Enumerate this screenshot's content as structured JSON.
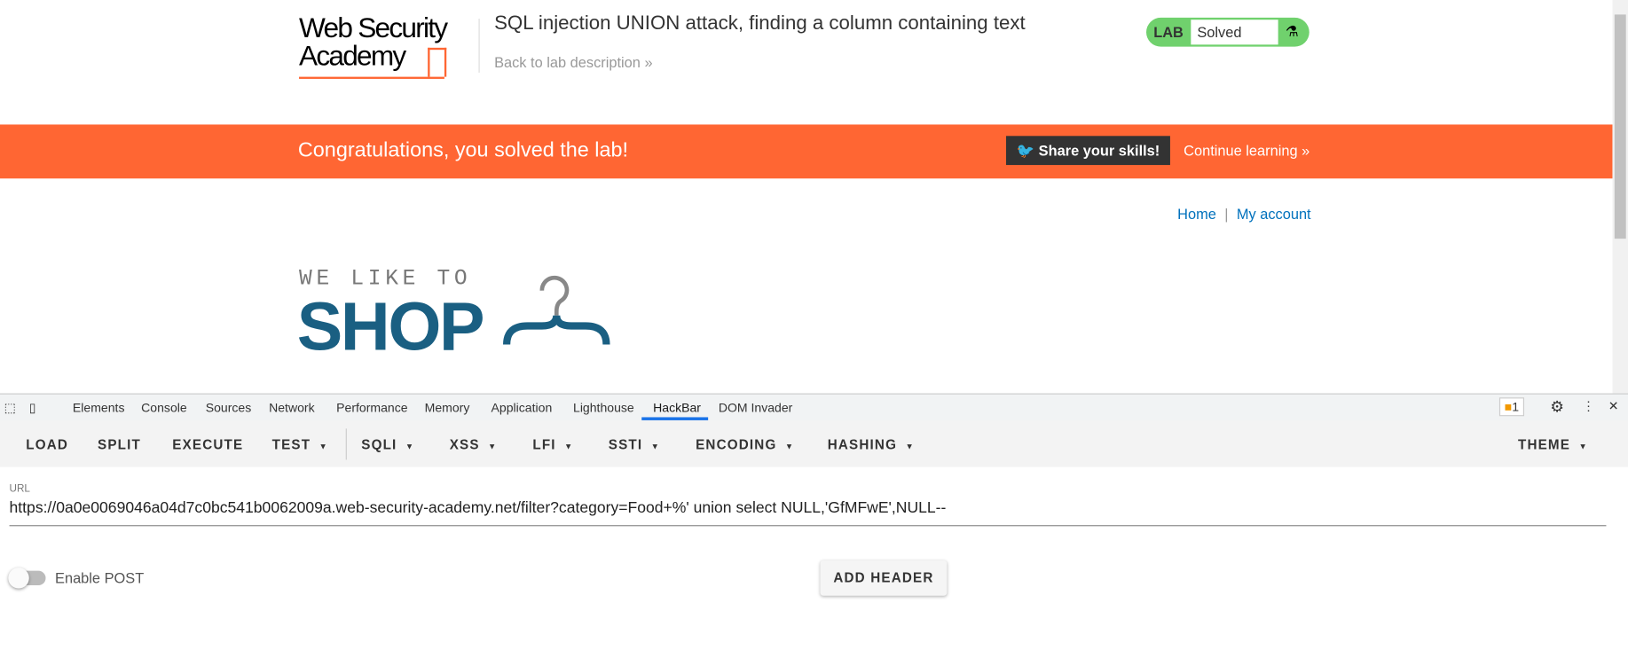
{
  "header": {
    "logo_line1": "Web Security",
    "logo_line2": "Academy",
    "title": "SQL injection UNION attack, finding a column containing text",
    "back_link": "Back to lab description »",
    "lab_label": "LAB",
    "lab_status": "Solved"
  },
  "banner": {
    "message": "Congratulations, you solved the lab!",
    "share": "Share your skills!",
    "continue": "Continue learning »"
  },
  "nav": {
    "home": "Home",
    "sep": "|",
    "account": "My account"
  },
  "shop_logo": {
    "line1": "WE LIKE TO",
    "line2": "SHOP"
  },
  "devtools": {
    "tabs": [
      "Elements",
      "Console",
      "Sources",
      "Network",
      "Performance",
      "Memory",
      "Application",
      "Lighthouse",
      "HackBar",
      "DOM Invader"
    ],
    "active_tab": "HackBar",
    "issues_count": "1"
  },
  "hackbar": {
    "buttons": [
      "LOAD",
      "SPLIT",
      "EXECUTE",
      "TEST",
      "SQLI",
      "XSS",
      "LFI",
      "SSTI",
      "ENCODING",
      "HASHING",
      "THEME"
    ],
    "url_label": "URL",
    "url_value": "https://0a0e0069046a04d7c0bc541b0062009a.web-security-academy.net/filter?category=Food+%'  union select  NULL,'GfMFwE',NULL--",
    "enable_post": "Enable POST",
    "add_header": "ADD HEADER"
  },
  "colors": {
    "accent": "#ff6633",
    "lab_green": "#70d16d",
    "shop_blue": "#1a5f82",
    "link": "#0071bc"
  }
}
